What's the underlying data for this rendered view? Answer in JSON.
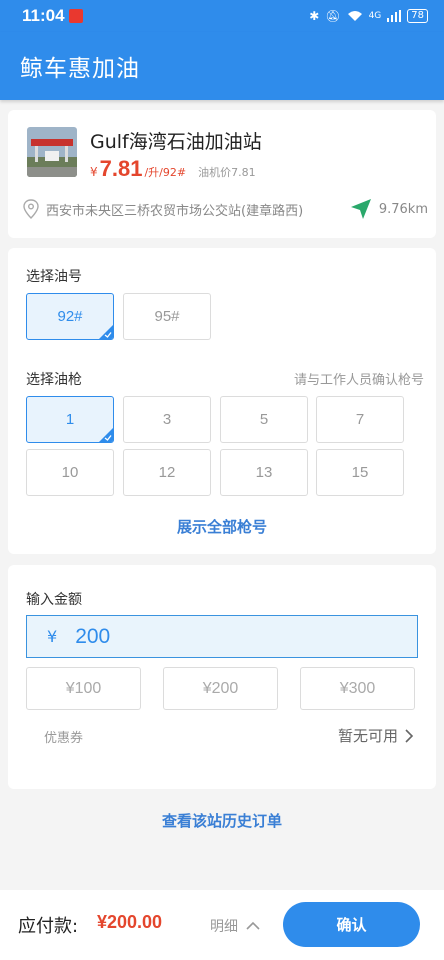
{
  "status_bar": {
    "time": "11:04",
    "battery": "78",
    "network": "4G"
  },
  "app_title": "鲸车惠加油",
  "station": {
    "name": "Gulf海湾石油加油站",
    "price_currency": "¥",
    "price": "7.81",
    "price_unit": "/升/92#",
    "machine_price": "油机价7.81",
    "address": "西安市未央区三桥农贸市场公交站(建章路西)",
    "distance": "9.76km"
  },
  "fuel": {
    "label": "选择油号",
    "options": [
      {
        "label": "92#",
        "selected": true
      },
      {
        "label": "95#",
        "selected": false
      }
    ]
  },
  "nozzle": {
    "label": "选择油枪",
    "hint": "请与工作人员确认枪号",
    "options": [
      {
        "label": "1",
        "selected": true
      },
      {
        "label": "3",
        "selected": false
      },
      {
        "label": "5",
        "selected": false
      },
      {
        "label": "7",
        "selected": false
      },
      {
        "label": "10",
        "selected": false
      },
      {
        "label": "12",
        "selected": false
      },
      {
        "label": "13",
        "selected": false
      },
      {
        "label": "15",
        "selected": false
      }
    ],
    "show_all": "展示全部枪号"
  },
  "amount": {
    "label": "输入金额",
    "currency": "¥",
    "value": "200",
    "quick": [
      "¥100",
      "¥200",
      "¥300"
    ],
    "coupon_label": "优惠券",
    "coupon_value": "暂无可用"
  },
  "history_link": "查看该站历史订单",
  "bottom": {
    "pay_label": "应付款:",
    "pay_amount": "¥200.00",
    "detail": "明细",
    "confirm": "确认"
  },
  "colors": {
    "primary": "#2f8ceb",
    "price_red": "#e4462d",
    "nav_green": "#2aa86b"
  }
}
